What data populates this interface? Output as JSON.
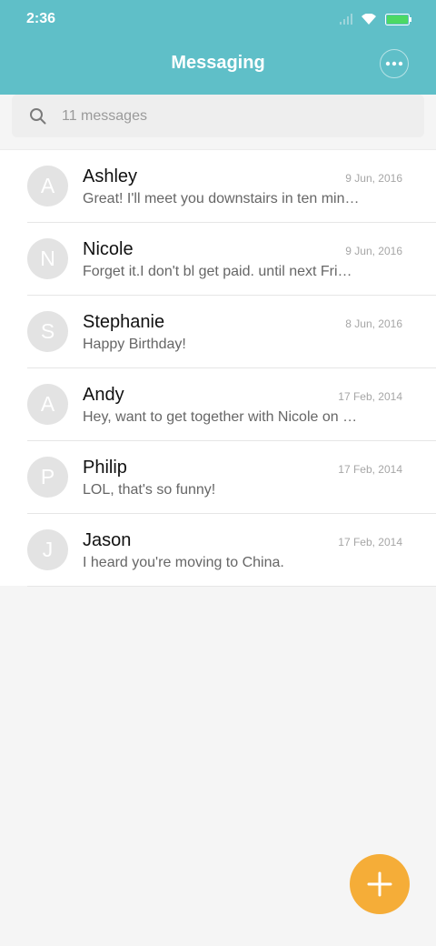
{
  "status_bar": {
    "time": "2:36",
    "icons": [
      "signal-icon",
      "wifi-icon",
      "battery-icon"
    ]
  },
  "header": {
    "title": "Messaging",
    "more_icon": "more-icon"
  },
  "search": {
    "icon": "search-icon",
    "placeholder": "11 messages"
  },
  "conversations": [
    {
      "initial": "A",
      "name": "Ashley",
      "date": "9 Jun, 2016",
      "preview": "Great! I'll meet you downstairs in ten min…"
    },
    {
      "initial": "N",
      "name": "Nicole",
      "date": "9 Jun, 2016",
      "preview": "Forget it.I don't bl get paid. until next Frid…"
    },
    {
      "initial": "S",
      "name": "Stephanie",
      "date": "8 Jun, 2016",
      "preview": "Happy Birthday!"
    },
    {
      "initial": "A",
      "name": "Andy",
      "date": "17 Feb, 2014",
      "preview": "Hey, want to get together with Nicole on …"
    },
    {
      "initial": "P",
      "name": "Philip",
      "date": "17 Feb, 2014",
      "preview": "LOL, that's so funny!"
    },
    {
      "initial": "J",
      "name": "Jason",
      "date": "17 Feb, 2014",
      "preview": "I heard you're moving to China."
    }
  ],
  "fab": {
    "icon": "plus-icon"
  },
  "colors": {
    "header": "#5fbfc8",
    "fab": "#f5ad38",
    "battery": "#4cd964",
    "background": "#f5f5f5"
  }
}
